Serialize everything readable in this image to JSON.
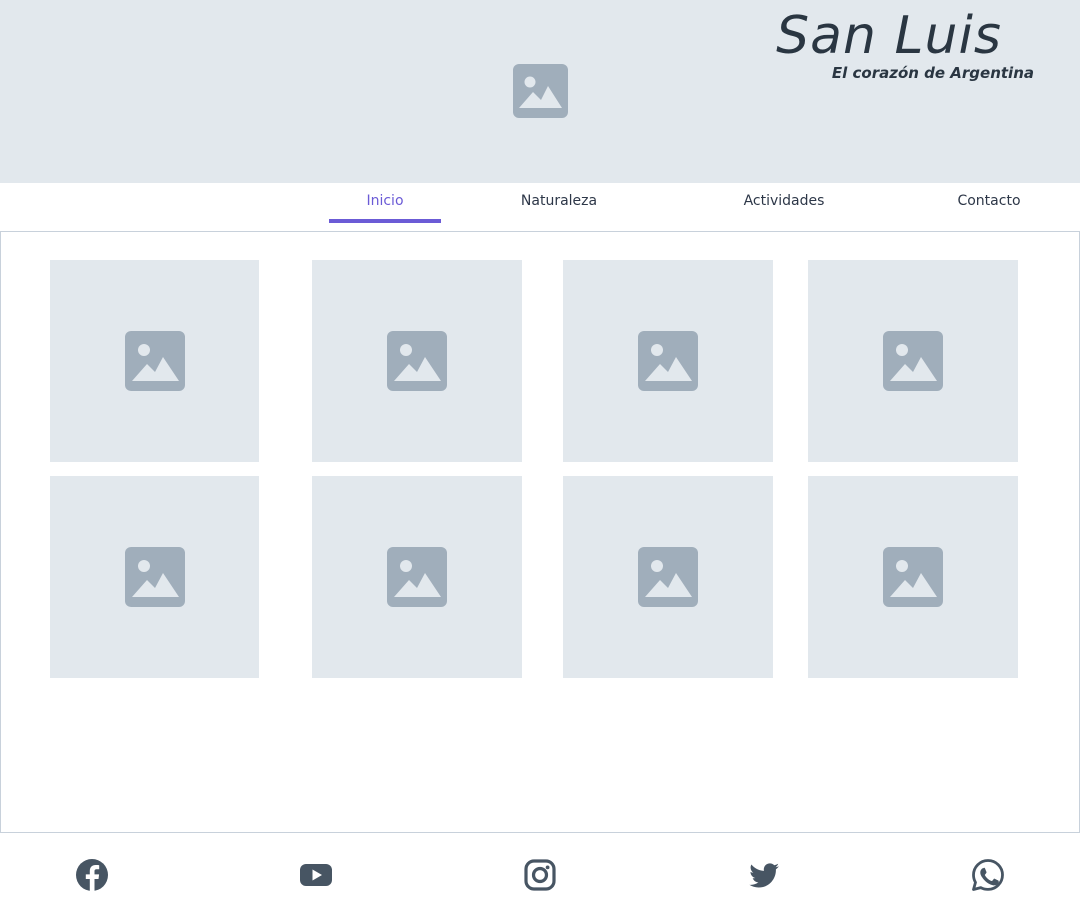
{
  "header": {
    "title": "San Luis",
    "subtitle": "El corazón de Argentina",
    "hero_icon": "image-placeholder-icon"
  },
  "nav": {
    "tabs": [
      {
        "label": "Inicio",
        "active": true
      },
      {
        "label": "Naturaleza",
        "active": false
      },
      {
        "label": "Actividades",
        "active": false
      },
      {
        "label": "Contacto",
        "active": false
      }
    ]
  },
  "gallery": {
    "count": 8,
    "item_icon": "image-placeholder-icon"
  },
  "footer": {
    "social": [
      "facebook-icon",
      "youtube-icon",
      "instagram-icon",
      "twitter-icon",
      "whatsapp-icon"
    ]
  },
  "colors": {
    "accent": "#6b5bd6",
    "placeholder_bg": "#e2e8ed",
    "placeholder_icon": "#a0aebb",
    "text_dark": "#2a3642",
    "icon_dark": "#475563"
  }
}
